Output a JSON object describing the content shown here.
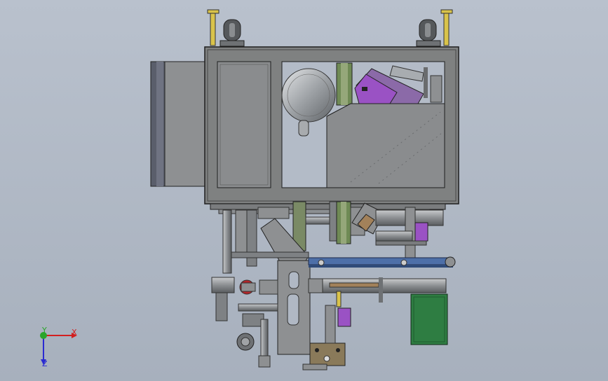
{
  "scene": {
    "background": "#b0b8c4",
    "frame_color": "#7f8181",
    "frame_edge": "#1e1e1e",
    "accent_purple": "#9a52c4",
    "accent_green": "#2e7d42",
    "accent_blue": "#4d6fa8",
    "accent_yellow": "#d9c34a",
    "accent_red": "#b3262a"
  },
  "triad": {
    "x_label": "X",
    "y_label": "Y",
    "z_label": "Z",
    "x_color": "#d21f1f",
    "y_color": "#2aa52a",
    "z_color": "#2a2ad2"
  }
}
